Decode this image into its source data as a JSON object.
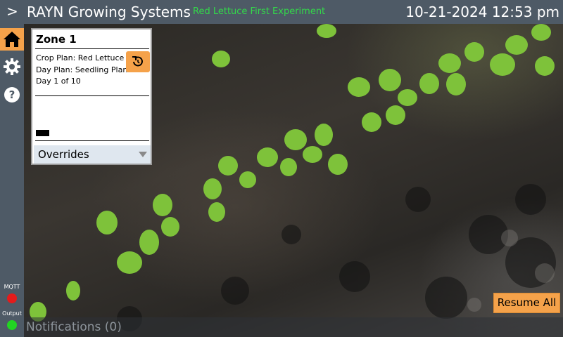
{
  "header": {
    "menu_glyph": ">",
    "title": "RAYN Growing Systems",
    "experiment": "Red Lettuce First Experiment",
    "datetime": "10-21-2024 12:53 pm"
  },
  "sidebar": {
    "items": [
      {
        "name": "home",
        "icon": "home-icon",
        "active": true
      },
      {
        "name": "settings",
        "icon": "gear-icon",
        "active": false
      },
      {
        "name": "help",
        "icon": "help-icon",
        "active": false
      }
    ],
    "status": [
      {
        "label": "MQTT",
        "color": "#e41b1b"
      },
      {
        "label": "Output",
        "color": "#22d422"
      }
    ]
  },
  "zone": {
    "title": "Zone 1",
    "crop_plan": "Crop Plan: Red Lettuce T",
    "day_plan": "Day Plan: Seedling Plan",
    "day": "Day 1 of 10",
    "overrides_label": "Overrides"
  },
  "notifications": "Notifications (0)",
  "resume_label": "Resume All",
  "colors": {
    "accent": "#f5a24a",
    "bar": "#4e5a66",
    "experiment_text": "#33d84a"
  }
}
